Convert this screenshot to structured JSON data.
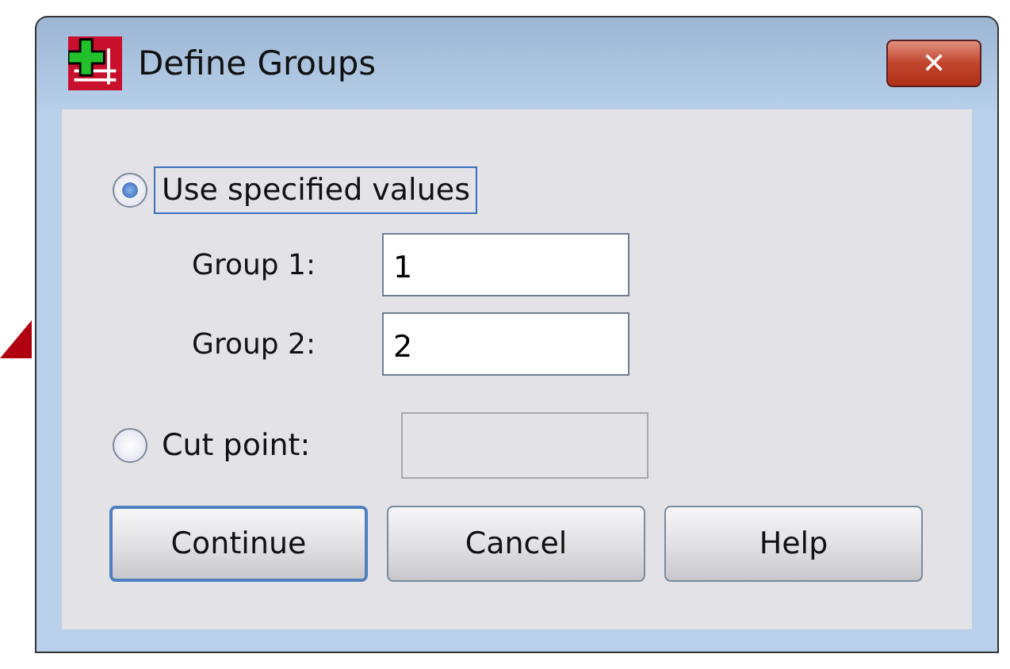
{
  "window": {
    "title": "Define Groups",
    "close": "✕"
  },
  "options": [
    {
      "kind": "radio",
      "label": "Use specified values",
      "selected": true,
      "focused": true
    },
    {
      "kind": "radio",
      "label": "Cut point:",
      "selected": false,
      "focused": false,
      "disabled": true
    }
  ],
  "groups": [
    {
      "label": "Group 1:",
      "value": "1"
    },
    {
      "label": "Group 2:",
      "value": "2"
    }
  ],
  "buttons": [
    {
      "label": "Continue",
      "default": true
    },
    {
      "label": "Cancel",
      "default": false
    },
    {
      "label": "Help",
      "default": false
    }
  ]
}
